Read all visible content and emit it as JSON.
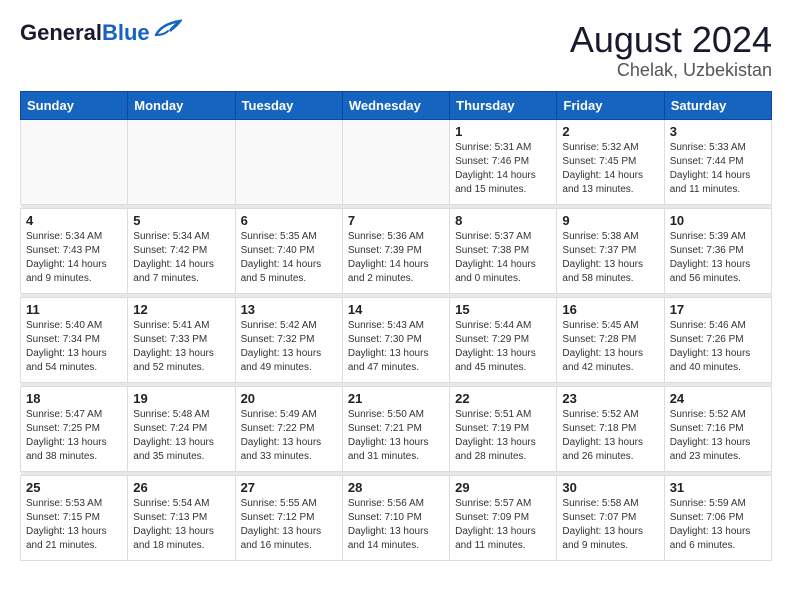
{
  "header": {
    "logo_general": "General",
    "logo_blue": "Blue",
    "month_title": "August 2024",
    "location": "Chelak, Uzbekistan"
  },
  "weekdays": [
    "Sunday",
    "Monday",
    "Tuesday",
    "Wednesday",
    "Thursday",
    "Friday",
    "Saturday"
  ],
  "weeks": [
    [
      {
        "day": "",
        "info": ""
      },
      {
        "day": "",
        "info": ""
      },
      {
        "day": "",
        "info": ""
      },
      {
        "day": "",
        "info": ""
      },
      {
        "day": "1",
        "info": "Sunrise: 5:31 AM\nSunset: 7:46 PM\nDaylight: 14 hours\nand 15 minutes."
      },
      {
        "day": "2",
        "info": "Sunrise: 5:32 AM\nSunset: 7:45 PM\nDaylight: 14 hours\nand 13 minutes."
      },
      {
        "day": "3",
        "info": "Sunrise: 5:33 AM\nSunset: 7:44 PM\nDaylight: 14 hours\nand 11 minutes."
      }
    ],
    [
      {
        "day": "4",
        "info": "Sunrise: 5:34 AM\nSunset: 7:43 PM\nDaylight: 14 hours\nand 9 minutes."
      },
      {
        "day": "5",
        "info": "Sunrise: 5:34 AM\nSunset: 7:42 PM\nDaylight: 14 hours\nand 7 minutes."
      },
      {
        "day": "6",
        "info": "Sunrise: 5:35 AM\nSunset: 7:40 PM\nDaylight: 14 hours\nand 5 minutes."
      },
      {
        "day": "7",
        "info": "Sunrise: 5:36 AM\nSunset: 7:39 PM\nDaylight: 14 hours\nand 2 minutes."
      },
      {
        "day": "8",
        "info": "Sunrise: 5:37 AM\nSunset: 7:38 PM\nDaylight: 14 hours\nand 0 minutes."
      },
      {
        "day": "9",
        "info": "Sunrise: 5:38 AM\nSunset: 7:37 PM\nDaylight: 13 hours\nand 58 minutes."
      },
      {
        "day": "10",
        "info": "Sunrise: 5:39 AM\nSunset: 7:36 PM\nDaylight: 13 hours\nand 56 minutes."
      }
    ],
    [
      {
        "day": "11",
        "info": "Sunrise: 5:40 AM\nSunset: 7:34 PM\nDaylight: 13 hours\nand 54 minutes."
      },
      {
        "day": "12",
        "info": "Sunrise: 5:41 AM\nSunset: 7:33 PM\nDaylight: 13 hours\nand 52 minutes."
      },
      {
        "day": "13",
        "info": "Sunrise: 5:42 AM\nSunset: 7:32 PM\nDaylight: 13 hours\nand 49 minutes."
      },
      {
        "day": "14",
        "info": "Sunrise: 5:43 AM\nSunset: 7:30 PM\nDaylight: 13 hours\nand 47 minutes."
      },
      {
        "day": "15",
        "info": "Sunrise: 5:44 AM\nSunset: 7:29 PM\nDaylight: 13 hours\nand 45 minutes."
      },
      {
        "day": "16",
        "info": "Sunrise: 5:45 AM\nSunset: 7:28 PM\nDaylight: 13 hours\nand 42 minutes."
      },
      {
        "day": "17",
        "info": "Sunrise: 5:46 AM\nSunset: 7:26 PM\nDaylight: 13 hours\nand 40 minutes."
      }
    ],
    [
      {
        "day": "18",
        "info": "Sunrise: 5:47 AM\nSunset: 7:25 PM\nDaylight: 13 hours\nand 38 minutes."
      },
      {
        "day": "19",
        "info": "Sunrise: 5:48 AM\nSunset: 7:24 PM\nDaylight: 13 hours\nand 35 minutes."
      },
      {
        "day": "20",
        "info": "Sunrise: 5:49 AM\nSunset: 7:22 PM\nDaylight: 13 hours\nand 33 minutes."
      },
      {
        "day": "21",
        "info": "Sunrise: 5:50 AM\nSunset: 7:21 PM\nDaylight: 13 hours\nand 31 minutes."
      },
      {
        "day": "22",
        "info": "Sunrise: 5:51 AM\nSunset: 7:19 PM\nDaylight: 13 hours\nand 28 minutes."
      },
      {
        "day": "23",
        "info": "Sunrise: 5:52 AM\nSunset: 7:18 PM\nDaylight: 13 hours\nand 26 minutes."
      },
      {
        "day": "24",
        "info": "Sunrise: 5:52 AM\nSunset: 7:16 PM\nDaylight: 13 hours\nand 23 minutes."
      }
    ],
    [
      {
        "day": "25",
        "info": "Sunrise: 5:53 AM\nSunset: 7:15 PM\nDaylight: 13 hours\nand 21 minutes."
      },
      {
        "day": "26",
        "info": "Sunrise: 5:54 AM\nSunset: 7:13 PM\nDaylight: 13 hours\nand 18 minutes."
      },
      {
        "day": "27",
        "info": "Sunrise: 5:55 AM\nSunset: 7:12 PM\nDaylight: 13 hours\nand 16 minutes."
      },
      {
        "day": "28",
        "info": "Sunrise: 5:56 AM\nSunset: 7:10 PM\nDaylight: 13 hours\nand 14 minutes."
      },
      {
        "day": "29",
        "info": "Sunrise: 5:57 AM\nSunset: 7:09 PM\nDaylight: 13 hours\nand 11 minutes."
      },
      {
        "day": "30",
        "info": "Sunrise: 5:58 AM\nSunset: 7:07 PM\nDaylight: 13 hours\nand 9 minutes."
      },
      {
        "day": "31",
        "info": "Sunrise: 5:59 AM\nSunset: 7:06 PM\nDaylight: 13 hours\nand 6 minutes."
      }
    ]
  ]
}
